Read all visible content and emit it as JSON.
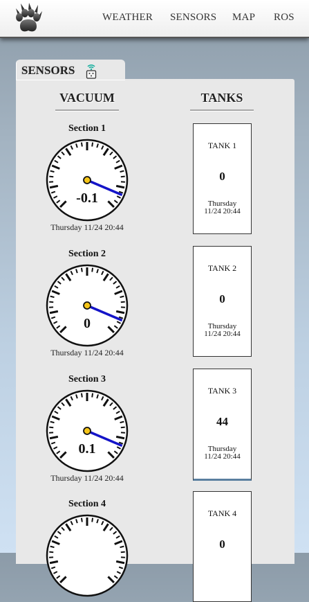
{
  "nav": {
    "items": [
      {
        "label": "WEATHER"
      },
      {
        "label": "SENSORS"
      },
      {
        "label": "MAP"
      },
      {
        "label": "ROS"
      }
    ]
  },
  "panel": {
    "tab_title": "SENSORS",
    "col_vacuum": "VACUUM",
    "col_tanks": "TANKS"
  },
  "sections": [
    {
      "title": "Section 1",
      "value": "-0.1",
      "time": "Thursday 11/24 20:44"
    },
    {
      "title": "Section 2",
      "value": "0",
      "time": "Thursday 11/24 20:44"
    },
    {
      "title": "Section 3",
      "value": "0.1",
      "time": "Thursday 11/24 20:44"
    },
    {
      "title": "Section 4",
      "value": "",
      "time": ""
    }
  ],
  "tanks": [
    {
      "title": "TANK 1",
      "value": "0",
      "day": "Thursday",
      "time": "11/24 20:44"
    },
    {
      "title": "TANK 2",
      "value": "0",
      "day": "Thursday",
      "time": "11/24 20:44"
    },
    {
      "title": "TANK 3",
      "value": "44",
      "day": "Thursday",
      "time": "11/24 20:44"
    },
    {
      "title": "TANK 4",
      "value": "0",
      "day": "",
      "time": ""
    }
  ],
  "colors": {
    "needle": "#1414c8",
    "hub": "#f5c518",
    "accent": "#1bb0a0"
  }
}
